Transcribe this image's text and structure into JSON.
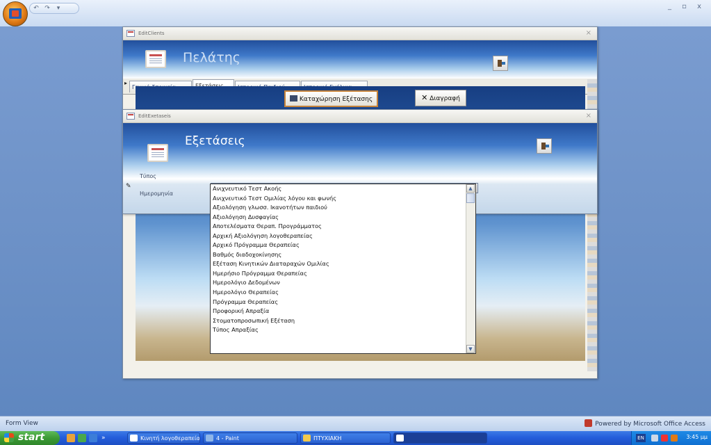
{
  "app": {
    "status_text": "Form View",
    "powered_by": "Powered by Microsoft Office Access",
    "window_controls": "_ ▫ x"
  },
  "pelates_window": {
    "title_bar": "EditClients",
    "header_title": "Πελάτης",
    "record_selector": "▸",
    "tabs": [
      "Γενικά Στοιχεία",
      "Εξετάσεις",
      "Ιστορικό Παιδιού",
      "Ιστορικό Ενήλικα"
    ],
    "active_tab": "Εξετάσεις",
    "record_button": "Καταχώρηση Εξέτασης",
    "delete_button": "Διαγραφή"
  },
  "exetaseis_window": {
    "title_bar": "EditExetaseis",
    "header_title": "Εξετάσεις",
    "record_indicator": "✎",
    "label_type": "Τύπος",
    "label_date": "Ημερομηνία",
    "combo_value": ""
  },
  "dropdown": {
    "items": [
      "Ανιχνευτικό Τεστ Ακοής",
      "Ανιχνευτικό Τεστ Ομιλίας λόγου και φωνής",
      "Αξιολόγηση γλωσσ. Ικανοτήτων παιδιού",
      "Αξιολόγηση Δυσφαγίας",
      "Αποτελέσματα Θεραπ. Προγράμματος",
      "Αρχική Αξιολόγηση λογοθεραπείας",
      "Αρχικό Πρόγραμμα Θεραπείας",
      "Βαθμός διαδοχοκίνησης",
      "Εξέταση Κινητικών Διαταραχών Ομιλίας",
      "Ημερήσιο Πρόγραμμα Θεραπείας",
      "Ημερολόγιο Δεδομένων",
      "Ημερολόγιο Θεραπείας",
      "Πρόγραμμα Θεραπείας",
      "Προφορική Απραξία",
      "Στοματοπροσωπική Εξέταση",
      "Τύπος Απραξίας"
    ],
    "scroll_up": "▲",
    "scroll_down": "▼"
  },
  "taskbar": {
    "start_label": "start",
    "tasks": [
      "Κινητή λογοθεραπεία...",
      "4 - Paint",
      "ΠΤΥΧΙΑΚΗ",
      ""
    ],
    "lang": "EN",
    "clock": "3:45 μμ"
  },
  "colors": {
    "workspace": "#6a8fc4",
    "taskbar": "#245edb",
    "start_green": "#3c9a35",
    "highlight_border": "#c7843a"
  }
}
